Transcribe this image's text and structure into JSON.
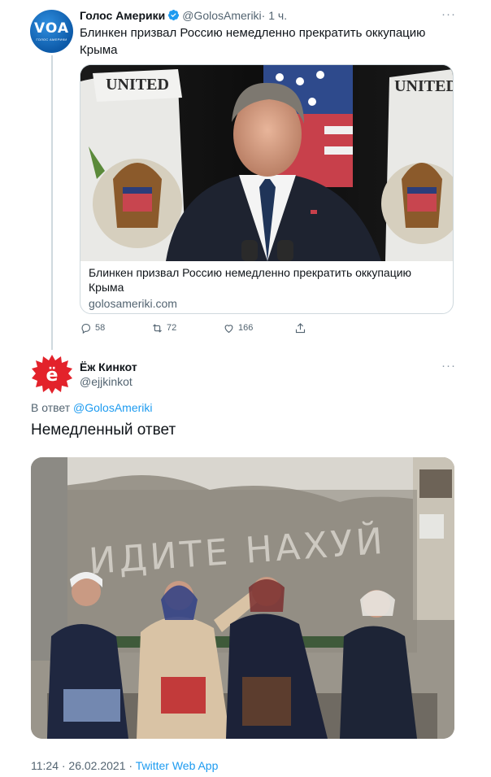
{
  "tweet1": {
    "author_name": "Голос Америки",
    "handle": "@GolosAmeriki",
    "time": "· 1 ч.",
    "avatar_text": "VOA",
    "avatar_subtext": "ГОЛОС АМЕРИКИ",
    "text": "Блинкен призвал Россию немедленно прекратить оккупацию Крыма",
    "card": {
      "title": "Блинкен призвал Россию немедленно прекратить оккупацию Крыма",
      "domain": "golosameriki.com"
    },
    "actions": {
      "replies": "58",
      "retweets": "72",
      "likes": "166"
    }
  },
  "tweet2": {
    "author_name": "Ёж Кинкот",
    "handle": "@ejjkinkot",
    "avatar_text": "ё",
    "reply_prefix": "В ответ",
    "reply_to": "@GolosAmeriki",
    "text": "Немедленный ответ",
    "photo_graffiti": "ИДИТЕ НАХУЙ",
    "timestamp": "11:24 · 26.02.2021 · ",
    "source": "Twitter Web App"
  },
  "colors": {
    "accent": "#1d9bf0",
    "muted": "#536471",
    "border": "#cfd9de",
    "voa_blue": "#0d5aa8",
    "ejj_red": "#e3222b"
  },
  "icons": [
    "verified-icon",
    "more-icon",
    "reply-icon",
    "retweet-icon",
    "like-icon",
    "share-icon"
  ]
}
